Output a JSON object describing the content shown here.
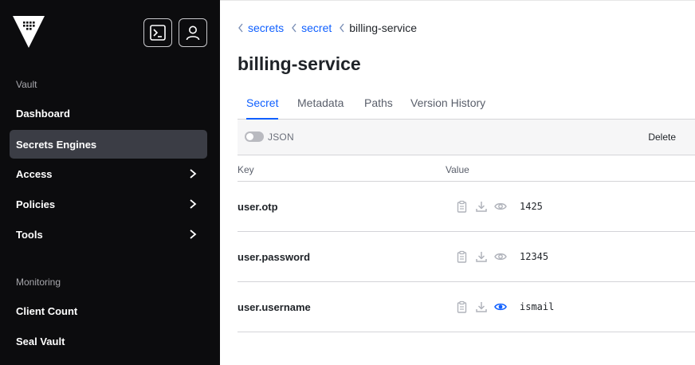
{
  "sidebar": {
    "sections": [
      {
        "label": "Vault"
      },
      {
        "label": "Monitoring"
      }
    ],
    "items": [
      {
        "label": "Dashboard",
        "active": false,
        "submenu": false
      },
      {
        "label": "Secrets Engines",
        "active": true,
        "submenu": false
      },
      {
        "label": "Access",
        "active": false,
        "submenu": true
      },
      {
        "label": "Policies",
        "active": false,
        "submenu": true
      },
      {
        "label": "Tools",
        "active": false,
        "submenu": true
      },
      {
        "label": "Client Count",
        "active": false,
        "submenu": false
      },
      {
        "label": "Seal Vault",
        "active": false,
        "submenu": false
      }
    ],
    "header_icons": [
      "terminal-icon",
      "user-icon"
    ]
  },
  "breadcrumb": [
    {
      "label": "secrets",
      "link": true
    },
    {
      "label": "secret",
      "link": true
    },
    {
      "label": "billing-service",
      "link": false
    }
  ],
  "page": {
    "title": "billing-service"
  },
  "tabs": [
    {
      "label": "Secret",
      "active": true
    },
    {
      "label": "Metadata",
      "active": false
    },
    {
      "label": "Paths",
      "active": false
    },
    {
      "label": "Version History",
      "active": false
    }
  ],
  "toolbar": {
    "json_label": "JSON",
    "json_enabled": false,
    "delete_label": "Delete"
  },
  "table": {
    "columns": [
      "Key",
      "Value"
    ],
    "rows": [
      {
        "key": "user.otp",
        "value": "1425",
        "revealed": false
      },
      {
        "key": "user.password",
        "value": "12345",
        "revealed": false
      },
      {
        "key": "user.username",
        "value": "ismail",
        "revealed": true
      }
    ]
  },
  "colors": {
    "sidebar_bg": "#0c0c0e",
    "active_item_bg": "#3b3d45",
    "accent": "#1060ff",
    "icon_muted": "#b0b3bb"
  }
}
